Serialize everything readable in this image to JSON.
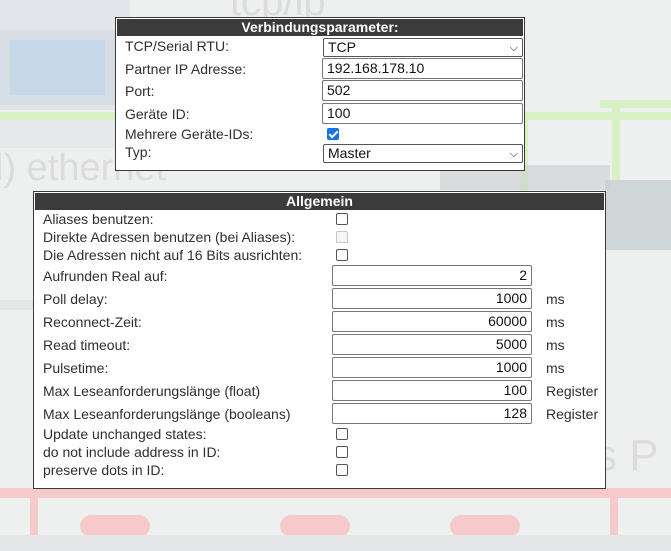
{
  "connection": {
    "title": "Verbindungsparameter:",
    "rows": {
      "mode": {
        "label": "TCP/Serial RTU:",
        "value": "TCP"
      },
      "ip": {
        "label": "Partner IP Adresse:",
        "value": "192.168.178.10"
      },
      "port": {
        "label": "Port:",
        "value": "502"
      },
      "device_id": {
        "label": "Geräte ID:",
        "value": "100"
      },
      "multi_ids": {
        "label": "Mehrere Geräte-IDs:",
        "checked": true
      },
      "type": {
        "label": "Typ:",
        "value": "Master"
      }
    }
  },
  "general": {
    "title": "Allgemein",
    "aliases": {
      "label": "Aliases benutzen:",
      "checked": false
    },
    "direct_addresses": {
      "label": "Direkte Adressen benutzen (bei Aliases):",
      "checked": false,
      "disabled": true
    },
    "align_16": {
      "label": "Die Adressen nicht auf 16 Bits ausrichten:",
      "checked": false
    },
    "round_real": {
      "label": "Aufrunden Real auf:",
      "value": "2"
    },
    "poll_delay": {
      "label": "Poll delay:",
      "value": "1000",
      "unit": "ms"
    },
    "reconnect": {
      "label": "Reconnect-Zeit:",
      "value": "60000",
      "unit": "ms"
    },
    "read_timeout": {
      "label": "Read timeout:",
      "value": "5000",
      "unit": "ms"
    },
    "pulsetime": {
      "label": "Pulsetime:",
      "value": "1000",
      "unit": "ms"
    },
    "max_float": {
      "label": "Max Leseanforderungslänge (float)",
      "value": "100",
      "unit": "Register"
    },
    "max_bool": {
      "label": "Max Leseanforderungslänge (booleans)",
      "value": "128",
      "unit": "Register"
    },
    "update_unchanged": {
      "label": "Update unchanged states:",
      "checked": false
    },
    "no_address": {
      "label": "do not include address in ID:",
      "checked": false
    },
    "preserve_dots": {
      "label": "preserve dots in ID:",
      "checked": false
    }
  },
  "background": {
    "words": [
      "tcp/ip",
      "l) ethernet",
      "s P"
    ],
    "line_color": "#c8e6a8",
    "accent_color": "#f3b7b7"
  }
}
